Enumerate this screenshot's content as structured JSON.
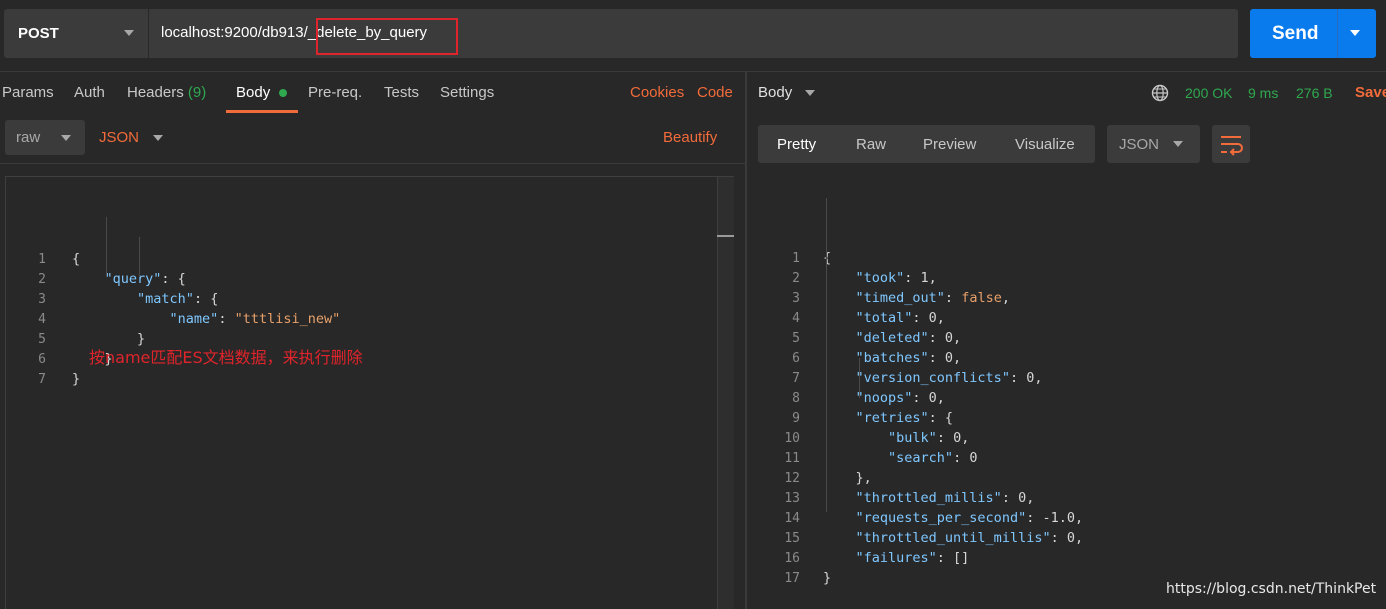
{
  "request": {
    "method": "POST",
    "url": "localhost:9200/db913/_delete_by_query",
    "send_label": "Send"
  },
  "request_tabs": {
    "params": "Params",
    "auth": "Auth",
    "headers": "Headers",
    "headers_count": "(9)",
    "body": "Body",
    "prereq": "Pre-req.",
    "tests": "Tests",
    "settings": "Settings",
    "cookies": "Cookies",
    "code": "Code"
  },
  "body_options": {
    "mode": "raw",
    "language": "JSON",
    "beautify": "Beautify"
  },
  "request_body": {
    "line_numbers": [
      "1",
      "2",
      "3",
      "4",
      "5",
      "6",
      "7"
    ],
    "lines": [
      [
        {
          "t": "{",
          "c": "n"
        }
      ],
      [
        {
          "t": "    ",
          "c": "n"
        },
        {
          "t": "\"query\"",
          "c": "k"
        },
        {
          "t": ": {",
          "c": "n"
        }
      ],
      [
        {
          "t": "        ",
          "c": "n"
        },
        {
          "t": "\"match\"",
          "c": "k"
        },
        {
          "t": ": {",
          "c": "n"
        }
      ],
      [
        {
          "t": "            ",
          "c": "n"
        },
        {
          "t": "\"name\"",
          "c": "k"
        },
        {
          "t": ": ",
          "c": "n"
        },
        {
          "t": "\"tttlisi_new\"",
          "c": "s"
        }
      ],
      [
        {
          "t": "        }",
          "c": "n"
        }
      ],
      [
        {
          "t": "    }",
          "c": "n"
        }
      ],
      [
        {
          "t": "}",
          "c": "n"
        }
      ]
    ]
  },
  "annotation": "按name匹配ES文档数据，来执行删除",
  "response": {
    "body_label": "Body",
    "status": "200 OK",
    "time": "9 ms",
    "size": "276 B",
    "save": "Save",
    "view_tabs": [
      "Pretty",
      "Raw",
      "Preview",
      "Visualize"
    ],
    "format": "JSON",
    "line_numbers": [
      "1",
      "2",
      "3",
      "4",
      "5",
      "6",
      "7",
      "8",
      "9",
      "10",
      "11",
      "12",
      "13",
      "14",
      "15",
      "16",
      "17"
    ],
    "lines": [
      [
        {
          "t": "{",
          "c": "n"
        }
      ],
      [
        {
          "t": "    ",
          "c": "n"
        },
        {
          "t": "\"took\"",
          "c": "k"
        },
        {
          "t": ": 1,",
          "c": "n"
        }
      ],
      [
        {
          "t": "    ",
          "c": "n"
        },
        {
          "t": "\"timed_out\"",
          "c": "k"
        },
        {
          "t": ": ",
          "c": "n"
        },
        {
          "t": "false",
          "c": "s"
        },
        {
          "t": ",",
          "c": "n"
        }
      ],
      [
        {
          "t": "    ",
          "c": "n"
        },
        {
          "t": "\"total\"",
          "c": "k"
        },
        {
          "t": ": 0,",
          "c": "n"
        }
      ],
      [
        {
          "t": "    ",
          "c": "n"
        },
        {
          "t": "\"deleted\"",
          "c": "k"
        },
        {
          "t": ": 0,",
          "c": "n"
        }
      ],
      [
        {
          "t": "    ",
          "c": "n"
        },
        {
          "t": "\"batches\"",
          "c": "k"
        },
        {
          "t": ": 0,",
          "c": "n"
        }
      ],
      [
        {
          "t": "    ",
          "c": "n"
        },
        {
          "t": "\"version_conflicts\"",
          "c": "k"
        },
        {
          "t": ": 0,",
          "c": "n"
        }
      ],
      [
        {
          "t": "    ",
          "c": "n"
        },
        {
          "t": "\"noops\"",
          "c": "k"
        },
        {
          "t": ": 0,",
          "c": "n"
        }
      ],
      [
        {
          "t": "    ",
          "c": "n"
        },
        {
          "t": "\"retries\"",
          "c": "k"
        },
        {
          "t": ": {",
          "c": "n"
        }
      ],
      [
        {
          "t": "        ",
          "c": "n"
        },
        {
          "t": "\"bulk\"",
          "c": "k"
        },
        {
          "t": ": 0,",
          "c": "n"
        }
      ],
      [
        {
          "t": "        ",
          "c": "n"
        },
        {
          "t": "\"search\"",
          "c": "k"
        },
        {
          "t": ": 0",
          "c": "n"
        }
      ],
      [
        {
          "t": "    },",
          "c": "n"
        }
      ],
      [
        {
          "t": "    ",
          "c": "n"
        },
        {
          "t": "\"throttled_millis\"",
          "c": "k"
        },
        {
          "t": ": 0,",
          "c": "n"
        }
      ],
      [
        {
          "t": "    ",
          "c": "n"
        },
        {
          "t": "\"requests_per_second\"",
          "c": "k"
        },
        {
          "t": ": -1.0,",
          "c": "n"
        }
      ],
      [
        {
          "t": "    ",
          "c": "n"
        },
        {
          "t": "\"throttled_until_millis\"",
          "c": "k"
        },
        {
          "t": ": 0,",
          "c": "n"
        }
      ],
      [
        {
          "t": "    ",
          "c": "n"
        },
        {
          "t": "\"failures\"",
          "c": "k"
        },
        {
          "t": ": []",
          "c": "n"
        }
      ],
      [
        {
          "t": "}",
          "c": "n"
        }
      ]
    ]
  },
  "watermark": "https://blog.csdn.net/ThinkPet",
  "colors": {
    "accent": "#f26b3a",
    "send": "#097bed",
    "status_ok": "#2fa84f",
    "highlight": "#e0242b"
  },
  "icons": {
    "method_caret": "chevron-down-icon",
    "send_caret": "chevron-down-icon",
    "network": "globe-icon",
    "wrap": "wrap-lines-icon"
  }
}
